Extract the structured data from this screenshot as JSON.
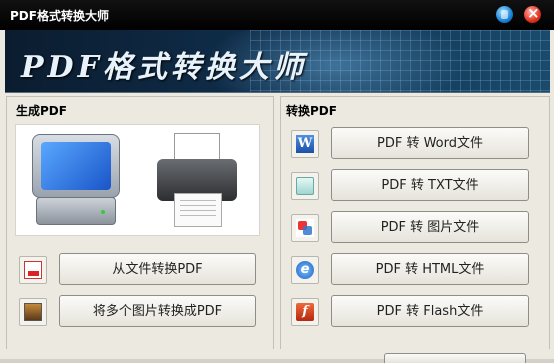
{
  "window": {
    "title": "PDF格式转换大师"
  },
  "banner": {
    "title": "PDF格式转换大师"
  },
  "left_panel": {
    "title": "生成PDF",
    "buttons": [
      {
        "label": "从文件转换PDF",
        "icon": "pdf-file-icon"
      },
      {
        "label": "将多个图片转换成PDF",
        "icon": "image-icon"
      }
    ]
  },
  "right_panel": {
    "title": "转换PDF",
    "buttons": [
      {
        "label": "PDF 转 Word文件",
        "icon": "word-icon"
      },
      {
        "label": "PDF 转 TXT文件",
        "icon": "txt-icon"
      },
      {
        "label": "PDF 转 图片文件",
        "icon": "picture-icon"
      },
      {
        "label": "PDF 转 HTML文件",
        "icon": "html-icon"
      },
      {
        "label": "PDF 转 Flash文件",
        "icon": "flash-icon"
      }
    ]
  }
}
